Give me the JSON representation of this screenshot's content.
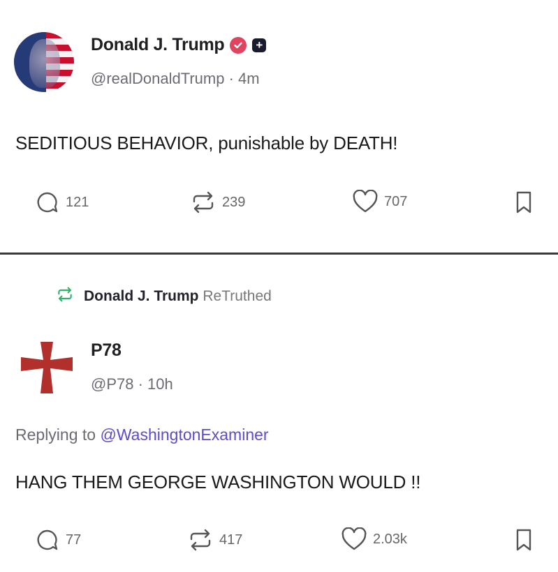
{
  "post1": {
    "display_name": "Donald J. Trump",
    "verified_icon": "verified-check-icon",
    "plus_icon": "plus-badge-icon",
    "plus_glyph": "+",
    "handle": "@realDonaldTrump · 4m",
    "text": "SEDITIOUS BEHAVIOR, punishable by DEATH!",
    "replies": "121",
    "retruths": "239",
    "likes": "707"
  },
  "post2": {
    "retruth_by": "Donald J. Trump",
    "retruth_label": "ReTruthed",
    "display_name": "P78",
    "handle": "@P78 · 10h",
    "replying_prefix": "Replying to",
    "replying_to": "@WashingtonExaminer",
    "text": "HANG THEM GEORGE WASHINGTON WOULD !!",
    "replies": "77",
    "retruths": "417",
    "likes": "2.03k"
  },
  "colors": {
    "verified": "#e2435f",
    "retruth_icon": "#2fb36b",
    "mention": "#5b4ccf",
    "cross": "#b2302c"
  }
}
